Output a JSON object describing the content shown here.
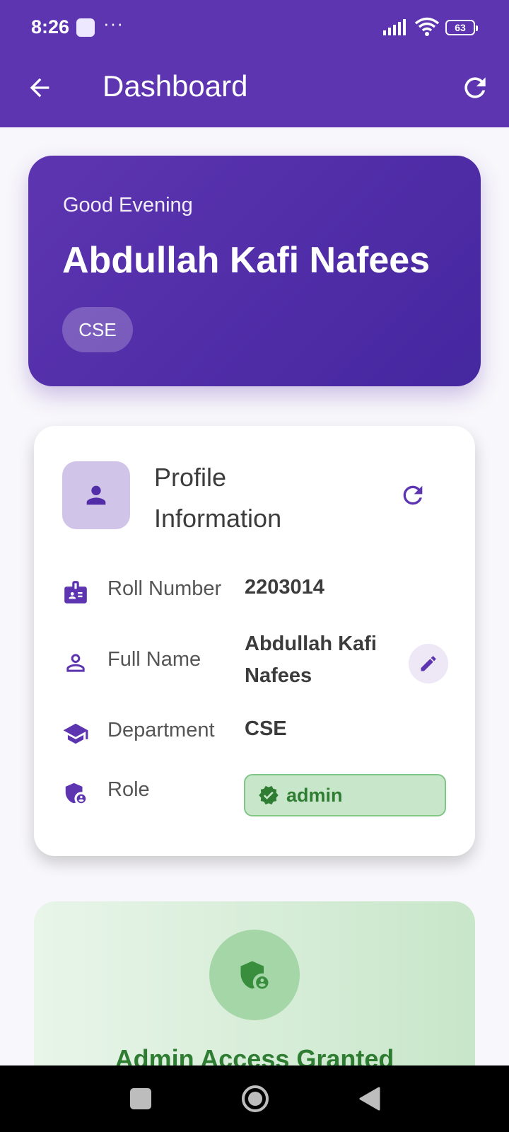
{
  "status_bar": {
    "time": "8:26",
    "dots": "···",
    "battery": "63",
    "icons": [
      "notification-icon",
      "signal-icon",
      "wifi-icon",
      "battery-icon"
    ]
  },
  "app_bar": {
    "title": "Dashboard",
    "back_icon": "arrow-back-icon",
    "refresh_icon": "refresh-icon",
    "color": "#5e35b1"
  },
  "greeting": {
    "text": "Good Evening",
    "name": "Abdullah Kafi Nafees",
    "department_chip": "CSE"
  },
  "profile": {
    "title": "Profile Information",
    "icon": "person-icon",
    "refresh_icon": "refresh-icon",
    "rows": [
      {
        "label": "Roll Number",
        "value": "2203014",
        "icon": "badge-icon"
      },
      {
        "label": "Full Name",
        "value": "Abdullah Kafi Nafees",
        "icon": "person-outline-icon",
        "action_icon": "edit-icon"
      },
      {
        "label": "Department",
        "value": "CSE",
        "icon": "school-icon"
      },
      {
        "label": "Role",
        "value": "admin",
        "icon": "admin-shield-icon",
        "badge_icon": "verified-icon"
      }
    ]
  },
  "admin_card": {
    "title": "Admin Access Granted",
    "icon": "admin-shield-icon",
    "color": "#2e7d32"
  },
  "nav_bar": {
    "icons": [
      "recents-icon",
      "home-icon",
      "back-icon"
    ]
  }
}
